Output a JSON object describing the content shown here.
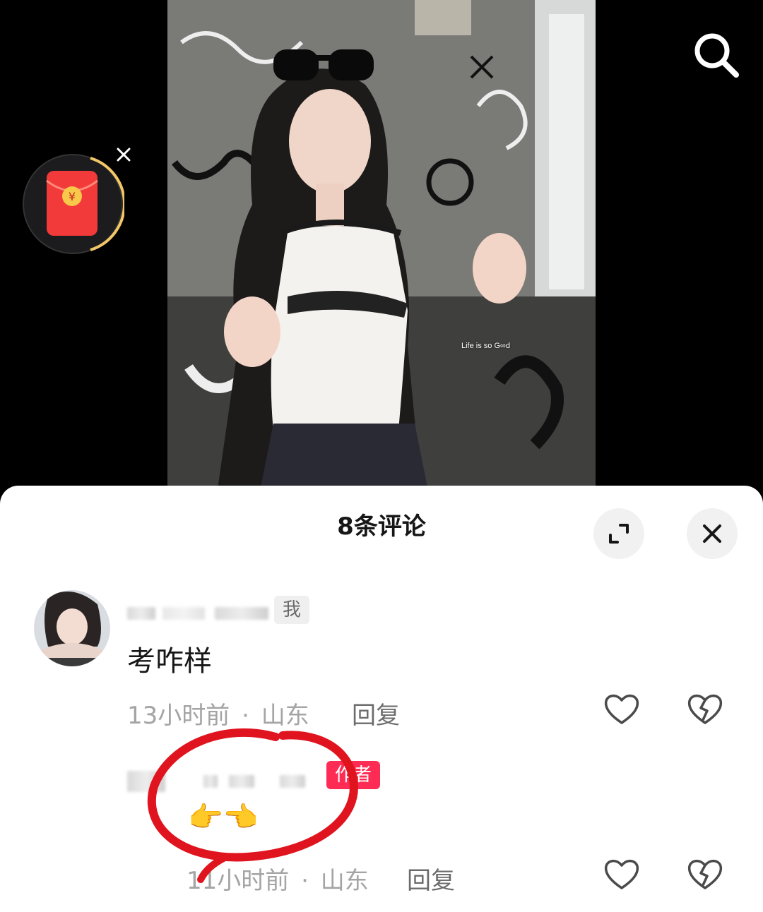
{
  "video": {
    "caption": "Life is so G∞d"
  },
  "comments_panel": {
    "title": "8条评论"
  },
  "comments": [
    {
      "badge": "我",
      "text": "考咋样",
      "time": "13小时前",
      "separator": "·",
      "location": "山东",
      "reply_label": "回复"
    },
    {
      "badge": "作者",
      "text": "👉👈",
      "time": "11小时前",
      "separator": "·",
      "location": "山东",
      "reply_label": "回复"
    }
  ],
  "colors": {
    "accent": "#fe2c55",
    "annotation": "#e0141e",
    "red_packet": "#f23a3a",
    "progress_ring": "#f3c768"
  },
  "icons": [
    "search-icon",
    "red-packet-icon",
    "close-icon",
    "expand-icon",
    "heart-icon",
    "broken-heart-icon"
  ]
}
